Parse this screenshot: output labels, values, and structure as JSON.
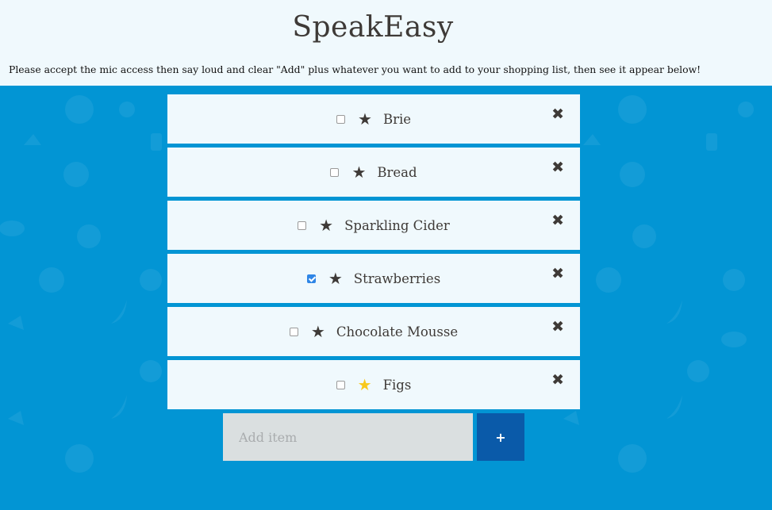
{
  "header": {
    "title": "SpeakEasy",
    "instructions": "Please accept the mic access then say loud and clear \"Add\" plus whatever you want to add to your shopping list, then see it appear below!"
  },
  "items": [
    {
      "label": "Brie",
      "checked": false,
      "favorite": false,
      "star_icon": "star-icon",
      "delete_icon": "close-icon"
    },
    {
      "label": "Bread",
      "checked": false,
      "favorite": false,
      "star_icon": "star-icon",
      "delete_icon": "close-icon"
    },
    {
      "label": "Sparkling Cider",
      "checked": false,
      "favorite": false,
      "star_icon": "star-icon",
      "delete_icon": "close-icon"
    },
    {
      "label": "Strawberries",
      "checked": true,
      "favorite": false,
      "star_icon": "star-icon",
      "delete_icon": "close-icon"
    },
    {
      "label": "Chocolate Mousse",
      "checked": false,
      "favorite": false,
      "star_icon": "star-icon",
      "delete_icon": "close-icon"
    },
    {
      "label": "Figs",
      "checked": false,
      "favorite": true,
      "star_icon": "star-icon",
      "delete_icon": "close-icon"
    }
  ],
  "glyphs": {
    "star": "★",
    "delete": "✖"
  },
  "add_form": {
    "placeholder": "Add item",
    "value": "",
    "button_label": "+"
  },
  "colors": {
    "background": "#0295d4",
    "header_bg": "#f0f9fd",
    "item_bg": "#f0f9fd",
    "text": "#3e3a37",
    "star_favorite": "#f8c81c",
    "checkbox_checked": "#2f86e6",
    "input_bg": "#dadfe0",
    "add_button_bg": "#0a5aa9"
  },
  "background_pattern_icon": "food-pattern-icon"
}
